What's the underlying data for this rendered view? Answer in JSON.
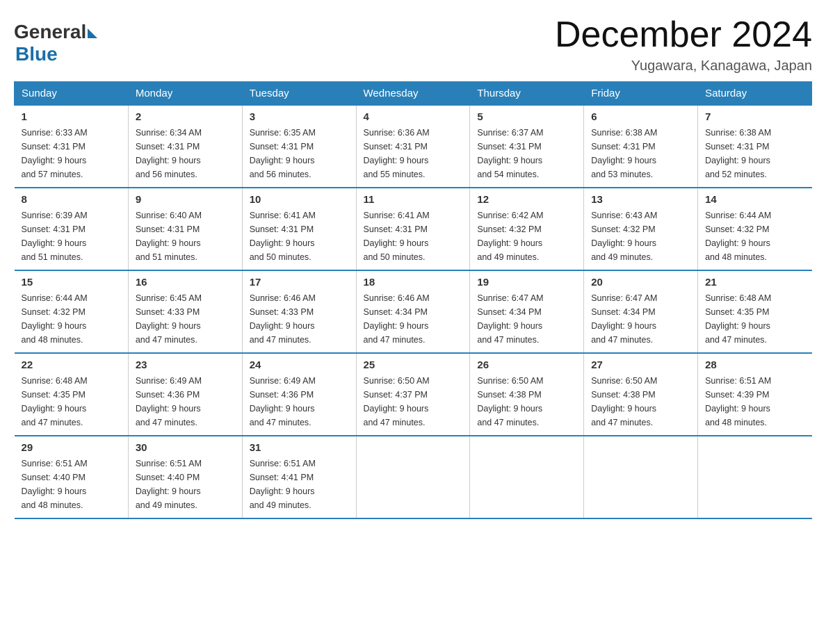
{
  "logo": {
    "general": "General",
    "blue": "Blue"
  },
  "title": "December 2024",
  "subtitle": "Yugawara, Kanagawa, Japan",
  "days_of_week": [
    "Sunday",
    "Monday",
    "Tuesday",
    "Wednesday",
    "Thursday",
    "Friday",
    "Saturday"
  ],
  "weeks": [
    [
      {
        "day": "1",
        "sunrise": "6:33 AM",
        "sunset": "4:31 PM",
        "daylight": "9 hours and 57 minutes."
      },
      {
        "day": "2",
        "sunrise": "6:34 AM",
        "sunset": "4:31 PM",
        "daylight": "9 hours and 56 minutes."
      },
      {
        "day": "3",
        "sunrise": "6:35 AM",
        "sunset": "4:31 PM",
        "daylight": "9 hours and 56 minutes."
      },
      {
        "day": "4",
        "sunrise": "6:36 AM",
        "sunset": "4:31 PM",
        "daylight": "9 hours and 55 minutes."
      },
      {
        "day": "5",
        "sunrise": "6:37 AM",
        "sunset": "4:31 PM",
        "daylight": "9 hours and 54 minutes."
      },
      {
        "day": "6",
        "sunrise": "6:38 AM",
        "sunset": "4:31 PM",
        "daylight": "9 hours and 53 minutes."
      },
      {
        "day": "7",
        "sunrise": "6:38 AM",
        "sunset": "4:31 PM",
        "daylight": "9 hours and 52 minutes."
      }
    ],
    [
      {
        "day": "8",
        "sunrise": "6:39 AM",
        "sunset": "4:31 PM",
        "daylight": "9 hours and 51 minutes."
      },
      {
        "day": "9",
        "sunrise": "6:40 AM",
        "sunset": "4:31 PM",
        "daylight": "9 hours and 51 minutes."
      },
      {
        "day": "10",
        "sunrise": "6:41 AM",
        "sunset": "4:31 PM",
        "daylight": "9 hours and 50 minutes."
      },
      {
        "day": "11",
        "sunrise": "6:41 AM",
        "sunset": "4:31 PM",
        "daylight": "9 hours and 50 minutes."
      },
      {
        "day": "12",
        "sunrise": "6:42 AM",
        "sunset": "4:32 PM",
        "daylight": "9 hours and 49 minutes."
      },
      {
        "day": "13",
        "sunrise": "6:43 AM",
        "sunset": "4:32 PM",
        "daylight": "9 hours and 49 minutes."
      },
      {
        "day": "14",
        "sunrise": "6:44 AM",
        "sunset": "4:32 PM",
        "daylight": "9 hours and 48 minutes."
      }
    ],
    [
      {
        "day": "15",
        "sunrise": "6:44 AM",
        "sunset": "4:32 PM",
        "daylight": "9 hours and 48 minutes."
      },
      {
        "day": "16",
        "sunrise": "6:45 AM",
        "sunset": "4:33 PM",
        "daylight": "9 hours and 47 minutes."
      },
      {
        "day": "17",
        "sunrise": "6:46 AM",
        "sunset": "4:33 PM",
        "daylight": "9 hours and 47 minutes."
      },
      {
        "day": "18",
        "sunrise": "6:46 AM",
        "sunset": "4:34 PM",
        "daylight": "9 hours and 47 minutes."
      },
      {
        "day": "19",
        "sunrise": "6:47 AM",
        "sunset": "4:34 PM",
        "daylight": "9 hours and 47 minutes."
      },
      {
        "day": "20",
        "sunrise": "6:47 AM",
        "sunset": "4:34 PM",
        "daylight": "9 hours and 47 minutes."
      },
      {
        "day": "21",
        "sunrise": "6:48 AM",
        "sunset": "4:35 PM",
        "daylight": "9 hours and 47 minutes."
      }
    ],
    [
      {
        "day": "22",
        "sunrise": "6:48 AM",
        "sunset": "4:35 PM",
        "daylight": "9 hours and 47 minutes."
      },
      {
        "day": "23",
        "sunrise": "6:49 AM",
        "sunset": "4:36 PM",
        "daylight": "9 hours and 47 minutes."
      },
      {
        "day": "24",
        "sunrise": "6:49 AM",
        "sunset": "4:36 PM",
        "daylight": "9 hours and 47 minutes."
      },
      {
        "day": "25",
        "sunrise": "6:50 AM",
        "sunset": "4:37 PM",
        "daylight": "9 hours and 47 minutes."
      },
      {
        "day": "26",
        "sunrise": "6:50 AM",
        "sunset": "4:38 PM",
        "daylight": "9 hours and 47 minutes."
      },
      {
        "day": "27",
        "sunrise": "6:50 AM",
        "sunset": "4:38 PM",
        "daylight": "9 hours and 47 minutes."
      },
      {
        "day": "28",
        "sunrise": "6:51 AM",
        "sunset": "4:39 PM",
        "daylight": "9 hours and 48 minutes."
      }
    ],
    [
      {
        "day": "29",
        "sunrise": "6:51 AM",
        "sunset": "4:40 PM",
        "daylight": "9 hours and 48 minutes."
      },
      {
        "day": "30",
        "sunrise": "6:51 AM",
        "sunset": "4:40 PM",
        "daylight": "9 hours and 49 minutes."
      },
      {
        "day": "31",
        "sunrise": "6:51 AM",
        "sunset": "4:41 PM",
        "daylight": "9 hours and 49 minutes."
      },
      null,
      null,
      null,
      null
    ]
  ],
  "labels": {
    "sunrise": "Sunrise:",
    "sunset": "Sunset:",
    "daylight": "Daylight:"
  }
}
